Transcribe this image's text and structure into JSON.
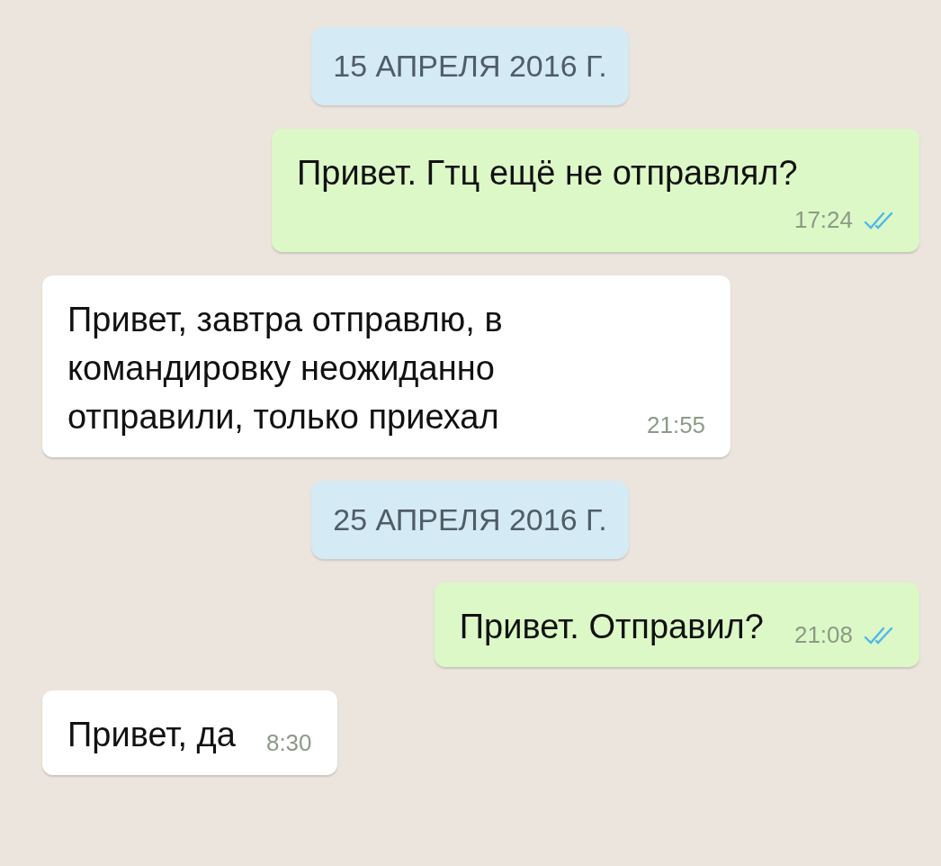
{
  "messages": [
    {
      "kind": "date",
      "text": "15 АПРЕЛЯ 2016 Г."
    },
    {
      "kind": "outgoing",
      "text": "Привет. Гтц ещё не отправлял?",
      "time": "17:24",
      "read": true
    },
    {
      "kind": "incoming",
      "text": "Привет, завтра отправлю, в командировку неожиданно отправили, только приехал",
      "time": "21:55"
    },
    {
      "kind": "date",
      "text": "25 АПРЕЛЯ 2016 Г."
    },
    {
      "kind": "outgoing",
      "text": "Привет. Отправил?",
      "time": "21:08",
      "read": true
    },
    {
      "kind": "incoming",
      "text": "Привет, да",
      "time": "8:30"
    }
  ]
}
